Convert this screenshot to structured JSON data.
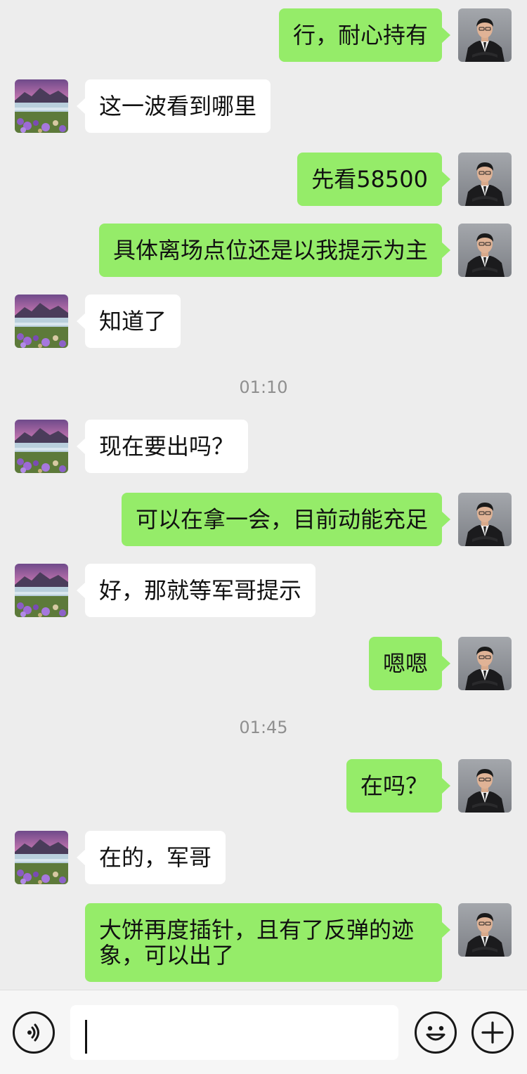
{
  "chat": {
    "messages": [
      {
        "side": "out",
        "text": "行，耐心持有"
      },
      {
        "side": "in",
        "text": "这一波看到哪里"
      },
      {
        "side": "out",
        "text": "先看58500"
      },
      {
        "side": "out",
        "text": "具体离场点位还是以我提示为主"
      },
      {
        "side": "in",
        "text": "知道了"
      },
      {
        "timestamp": "01:10"
      },
      {
        "side": "in",
        "text": "现在要出吗？"
      },
      {
        "side": "out",
        "text": "可以在拿一会，目前动能充足"
      },
      {
        "side": "in",
        "text": "好，那就等军哥提示"
      },
      {
        "side": "out",
        "text": "嗯嗯"
      },
      {
        "timestamp": "01:45"
      },
      {
        "side": "out",
        "text": "在吗？"
      },
      {
        "side": "in",
        "text": "在的，军哥"
      },
      {
        "side": "out",
        "text": "大饼再度插针，且有了反弹的迹象，可以出了"
      }
    ]
  },
  "input_bar": {
    "voice_icon": "voice-icon",
    "emoji_icon": "emoji-icon",
    "plus_icon": "plus-icon",
    "input_value": ""
  },
  "colors": {
    "background": "#ededed",
    "outgoing_bubble": "#95ec69",
    "incoming_bubble": "#ffffff",
    "timestamp_text": "#8f8f8f"
  }
}
